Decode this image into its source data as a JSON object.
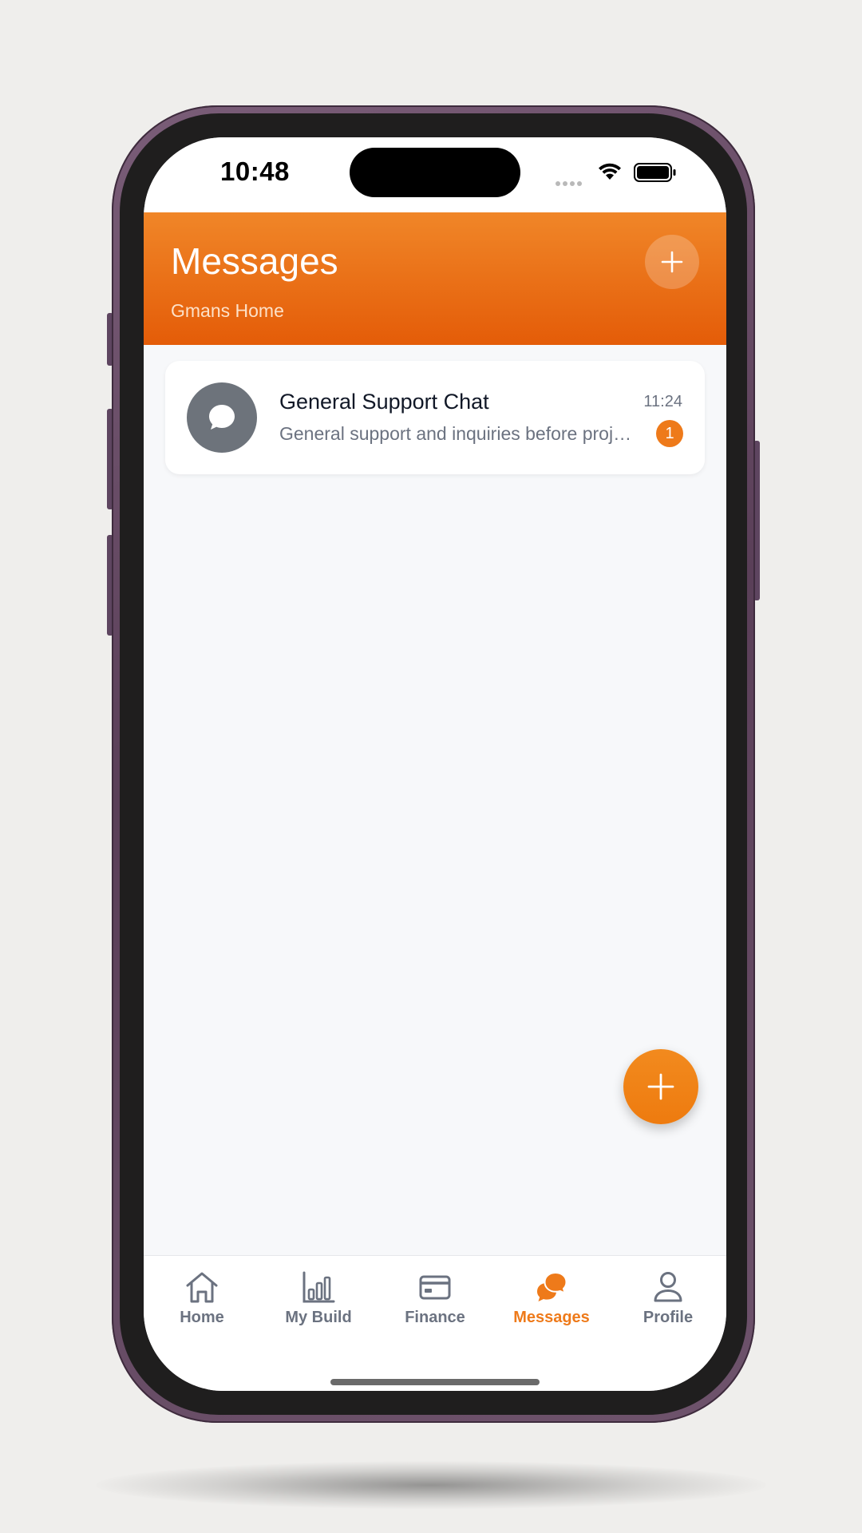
{
  "status_bar": {
    "time": "10:48"
  },
  "header": {
    "title": "Messages",
    "subtitle": "Gmans Home",
    "add_icon": "plus-icon"
  },
  "conversations": [
    {
      "title": "General Support Chat",
      "preview": "General support and inquiries before project starts",
      "time": "11:24",
      "unread": "1",
      "icon": "chat-bubble-icon"
    }
  ],
  "fab": {
    "icon": "plus-icon"
  },
  "tabs": [
    {
      "label": "Home",
      "icon": "home-icon",
      "active": false
    },
    {
      "label": "My Build",
      "icon": "bar-chart-icon",
      "active": false
    },
    {
      "label": "Finance",
      "icon": "credit-card-icon",
      "active": false
    },
    {
      "label": "Messages",
      "icon": "chat-bubbles-icon",
      "active": true
    },
    {
      "label": "Profile",
      "icon": "person-icon",
      "active": false
    }
  ],
  "colors": {
    "accent": "#ee7a1a",
    "header_top": "#f08628",
    "header_bottom": "#e45c08",
    "inactive_tab": "#6b7280",
    "avatar": "#6d737b"
  }
}
